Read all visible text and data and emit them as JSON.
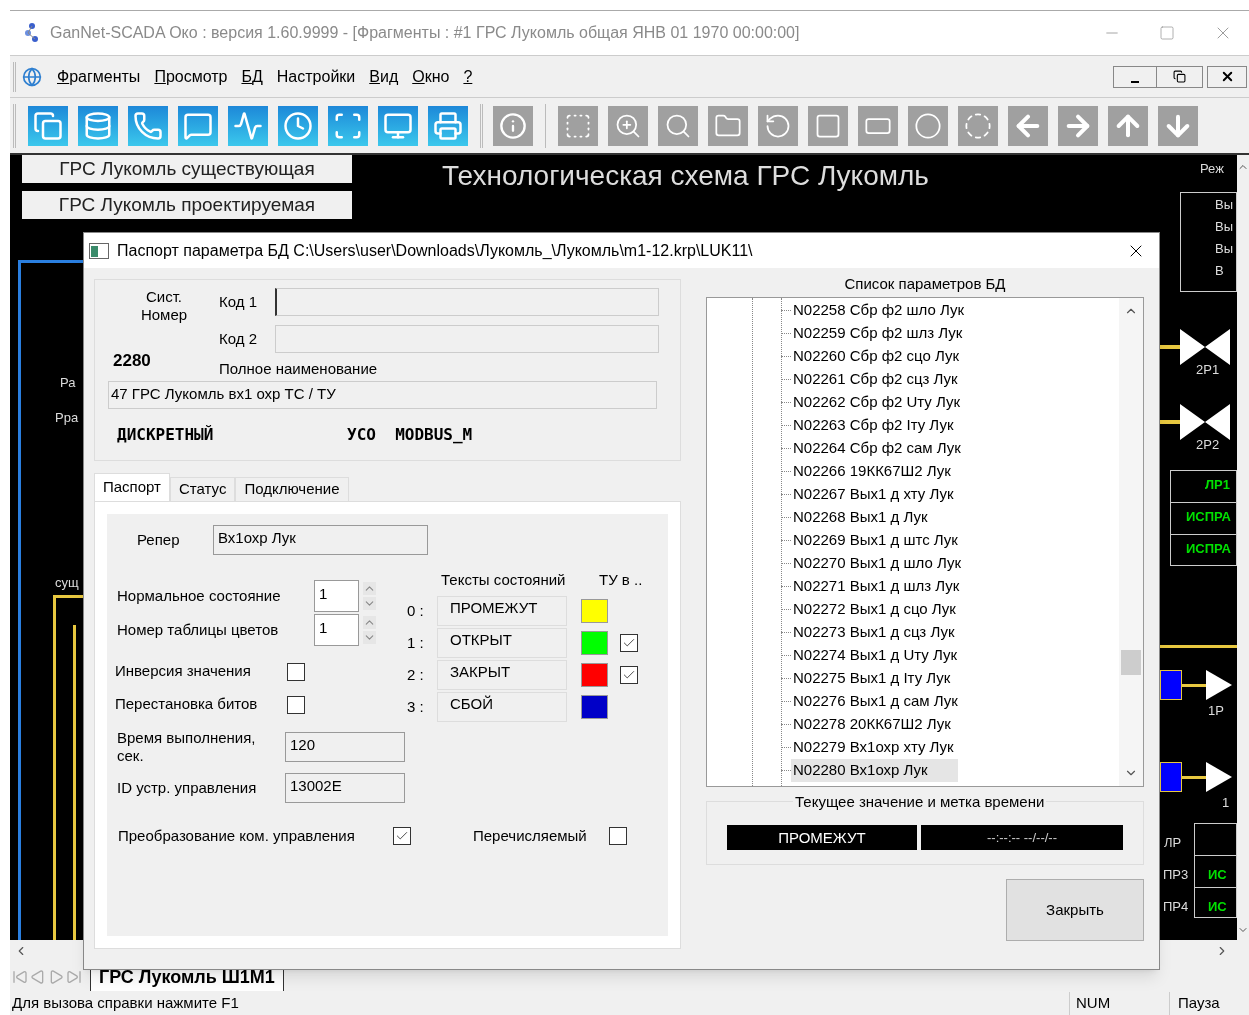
{
  "window": {
    "title": "GanNet-SCADA Око :  версия 1.60.9999 - [Фрагменты : #1 ГРС Лукомль общая  ЯНВ 01 1970 00:00:00]"
  },
  "menu": [
    {
      "label": "Фрагменты",
      "accelerator_underlined": true
    },
    {
      "label": "Просмотр",
      "accelerator_underlined": true
    },
    {
      "label": "БД",
      "accelerator_underlined": true
    },
    {
      "label": "Настройки",
      "accelerator_underlined": false
    },
    {
      "label": "Вид",
      "accelerator_underlined": true
    },
    {
      "label": "Окно",
      "accelerator_underlined": true
    },
    {
      "label": "?",
      "accelerator_underlined": true
    }
  ],
  "schematic": {
    "buttons": [
      "ГРС Лукомль существующая",
      "ГРС Лукомль проектируемая"
    ],
    "title": "Технологическая схема ГРС Лукомль",
    "labels": [
      {
        "text": "Реж",
        "kind": "label"
      },
      {
        "text": "Вы",
        "kind": "label"
      },
      {
        "text": "Вы",
        "kind": "label"
      },
      {
        "text": "Вы",
        "kind": "label"
      },
      {
        "text": "В",
        "kind": "label"
      },
      {
        "text": "2Р1",
        "kind": "label"
      },
      {
        "text": "2Р2",
        "kind": "label"
      },
      {
        "text": "ЛР1",
        "kind": "status"
      },
      {
        "text": "ИСПРА",
        "kind": "status"
      },
      {
        "text": "ИСПРА",
        "kind": "status"
      },
      {
        "text": "1Р",
        "kind": "label"
      },
      {
        "text": "1",
        "kind": "label"
      },
      {
        "text": "ЛР",
        "kind": "label"
      },
      {
        "text": "ПР3",
        "kind": "label"
      },
      {
        "text": "ПР4",
        "kind": "label"
      },
      {
        "text": "ИС",
        "kind": "status"
      },
      {
        "text": "ИС",
        "kind": "status"
      },
      {
        "text": "Ра",
        "kind": "label"
      },
      {
        "text": "Рра",
        "kind": "label"
      },
      {
        "text": "сущ",
        "kind": "label"
      }
    ]
  },
  "dialog": {
    "title": "Паспорт параметра БД C:\\Users\\user\\Downloads\\Лукомль_\\Лукомль\\m1-12.krp\\LUK11\\",
    "sys_number_label": "Сист. Номер",
    "sys_number": "2280",
    "code1_label": "Код 1",
    "code2_label": "Код 2",
    "full_name_label": "Полное наименование",
    "full_name": "47 ГРС Лукомль вх1 охр  ТС / ТУ",
    "type": "ДИСКРЕТНЫЙ",
    "uso": "УСО  MODBUS_M",
    "tabs": [
      {
        "label": "Паспорт",
        "selected": true
      },
      {
        "label": "Статус",
        "selected": false
      },
      {
        "label": "Подключение",
        "selected": false
      }
    ],
    "reper_label": "Репер",
    "reper": "Вх1охр Лук",
    "normal_state_label": "Нормальное состояние",
    "normal_state": "1",
    "color_table_label": "Номер таблицы цветов",
    "color_table": "1",
    "inversion": {
      "label": "Инверсия значения",
      "checked": false
    },
    "bit_swap": {
      "label": "Перестановка битов",
      "checked": false
    },
    "exec_time_label": "Время выполнения, сек.",
    "exec_time": "120",
    "device_id_label": "ID устр. управления",
    "device_id": "13002E",
    "command_conversion": {
      "label": "Преобразование ком. управления",
      "checked": true
    },
    "enumerable": {
      "label": "Перечисляемый",
      "checked": false
    },
    "states_header": "Тексты состояний",
    "tu_header": "ТУ в ..",
    "states": [
      {
        "index": "0 :",
        "text": "ПРОМЕЖУТ",
        "color": "#ffff00"
      },
      {
        "index": "1 :",
        "text": "ОТКРЫТ",
        "color": "#00ff00",
        "tu": true
      },
      {
        "index": "2 :",
        "text": "ЗАКРЫТ",
        "color": "#ff0000",
        "tu": true
      },
      {
        "index": "3 :",
        "text": "СБОЙ",
        "color": "#0000c8"
      }
    ],
    "list_title": "Список параметров БД",
    "params": [
      {
        "label": "N02258 Сбр ф2 шло Лук",
        "selected": false
      },
      {
        "label": "N02259 Сбр ф2 шлз Лук",
        "selected": false
      },
      {
        "label": "N02260 Сбр ф2 сцо Лук",
        "selected": false
      },
      {
        "label": "N02261 Сбр ф2 сцз Лук",
        "selected": false
      },
      {
        "label": "N02262 Сбр ф2 Uту Лук",
        "selected": false
      },
      {
        "label": "N02263 Сбр ф2 Iту Лук",
        "selected": false
      },
      {
        "label": "N02264 Сбр ф2 сам Лук",
        "selected": false
      },
      {
        "label": "N02266 19КК67Ш2 Лук",
        "selected": false
      },
      {
        "label": "N02267 Вых1 д хту Лук",
        "selected": false
      },
      {
        "label": "N02268 Вых1 д Лук",
        "selected": false
      },
      {
        "label": "N02269 Вых1 д штс Лук",
        "selected": false
      },
      {
        "label": "N02270 Вых1 д шло Лук",
        "selected": false
      },
      {
        "label": "N02271 Вых1 д шлз Лук",
        "selected": false
      },
      {
        "label": "N02272 Вых1 д сцо Лук",
        "selected": false
      },
      {
        "label": "N02273 Вых1 д сцз Лук",
        "selected": false
      },
      {
        "label": "N02274 Вых1 д Uту Лук",
        "selected": false
      },
      {
        "label": "N02275 Вых1 д Iту Лук",
        "selected": false
      },
      {
        "label": "N02276 Вых1 д сам Лук",
        "selected": false
      },
      {
        "label": "N02278 20КК67Ш2 Лук",
        "selected": false
      },
      {
        "label": "N02279 Вх1охр хту Лук",
        "selected": false
      },
      {
        "label": "N02280 Вх1охр Лук",
        "selected": true
      }
    ],
    "current_title": "Текущее значение и метка времени",
    "current_value": "ПРОМЕЖУТ",
    "current_time": "--:--:-- --/--/--",
    "close_button": "Закрыть"
  },
  "sheet_tab": "ГРС Лукомль Ш1М1",
  "status_bar": {
    "hint": "Для вызова справки нажмите F1",
    "num": "NUM",
    "pause": "Пауза"
  }
}
